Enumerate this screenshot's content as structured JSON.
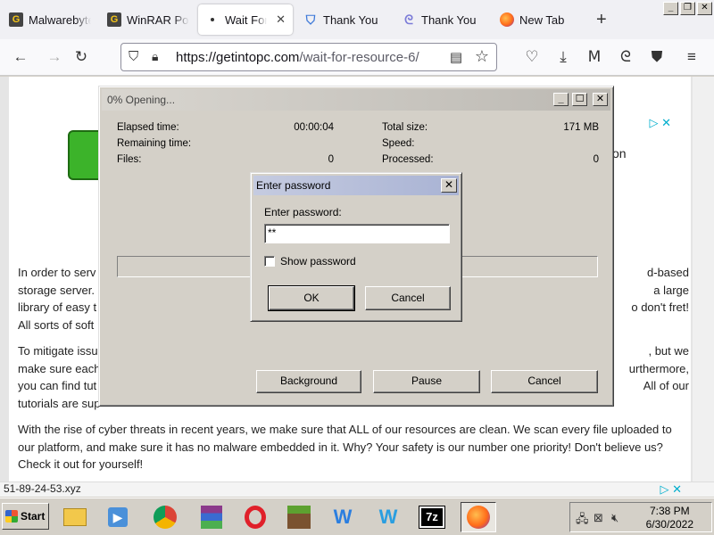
{
  "browser": {
    "tabs": [
      {
        "label": "Malwarebytes",
        "icon": "getintopc-g-icon",
        "active": false
      },
      {
        "label": "WinRAR Portable",
        "icon": "getintopc-g-icon",
        "active": false
      },
      {
        "label": "Wait For R",
        "icon": "page-dot-icon",
        "active": true
      },
      {
        "label": "Thank You",
        "icon": "shield-icon",
        "active": false
      },
      {
        "label": "Thank You",
        "icon": "swirl-icon",
        "active": false
      },
      {
        "label": "New Tab",
        "icon": "firefox-icon",
        "active": false
      }
    ],
    "url_host": "https://getintopc.com",
    "url_path": "/wait-for-resource-6/"
  },
  "page": {
    "paragraphs": [
      {
        "left": "In order to serv",
        "right": "d-based",
        "left2": "storage server.",
        "right2": "a large",
        "left3": "library of easy t",
        "right3": "o don't fret!",
        "left4": "All sorts of soft"
      },
      {
        "left": "To mitigate issu",
        "right": ", but we",
        "left2": "make sure each",
        "right2": "urthermore,",
        "left3": "you can find tut",
        "right3": "All of our",
        "left4": "tutorials are sup"
      }
    ],
    "bottom_paragraph": "With the rise of cyber threats in recent years, we make sure that ALL of our resources are clean. We scan every file uploaded to our platform, and make sure it has no malware embedded in it. Why? Your safety is our number one priority! Don't believe us? Check it out for yourself!",
    "ad_tail_text": "on"
  },
  "winrar": {
    "title": "0% Opening...",
    "stats_left": [
      {
        "label": "Elapsed time:",
        "value": "00:00:04"
      },
      {
        "label": "Remaining time:",
        "value": ""
      },
      {
        "label": "Files:",
        "value": "0"
      }
    ],
    "stats_right": [
      {
        "label": "Total size:",
        "value": "171 MB"
      },
      {
        "label": "Speed:",
        "value": ""
      },
      {
        "label": "Processed:",
        "value": "0"
      }
    ],
    "progress_fraction": 0,
    "buttons": {
      "background": "Background",
      "pause": "Pause",
      "cancel": "Cancel"
    }
  },
  "password_dialog": {
    "title": "Enter password",
    "label": "Enter password:",
    "value": "**",
    "show_password_label": "Show password",
    "show_password_checked": false,
    "ok": "OK",
    "cancel": "Cancel"
  },
  "status": {
    "text": "51-89-24-53.xyz"
  },
  "taskbar": {
    "start": "Start",
    "time": "7:38 PM",
    "date": "6/30/2022"
  }
}
